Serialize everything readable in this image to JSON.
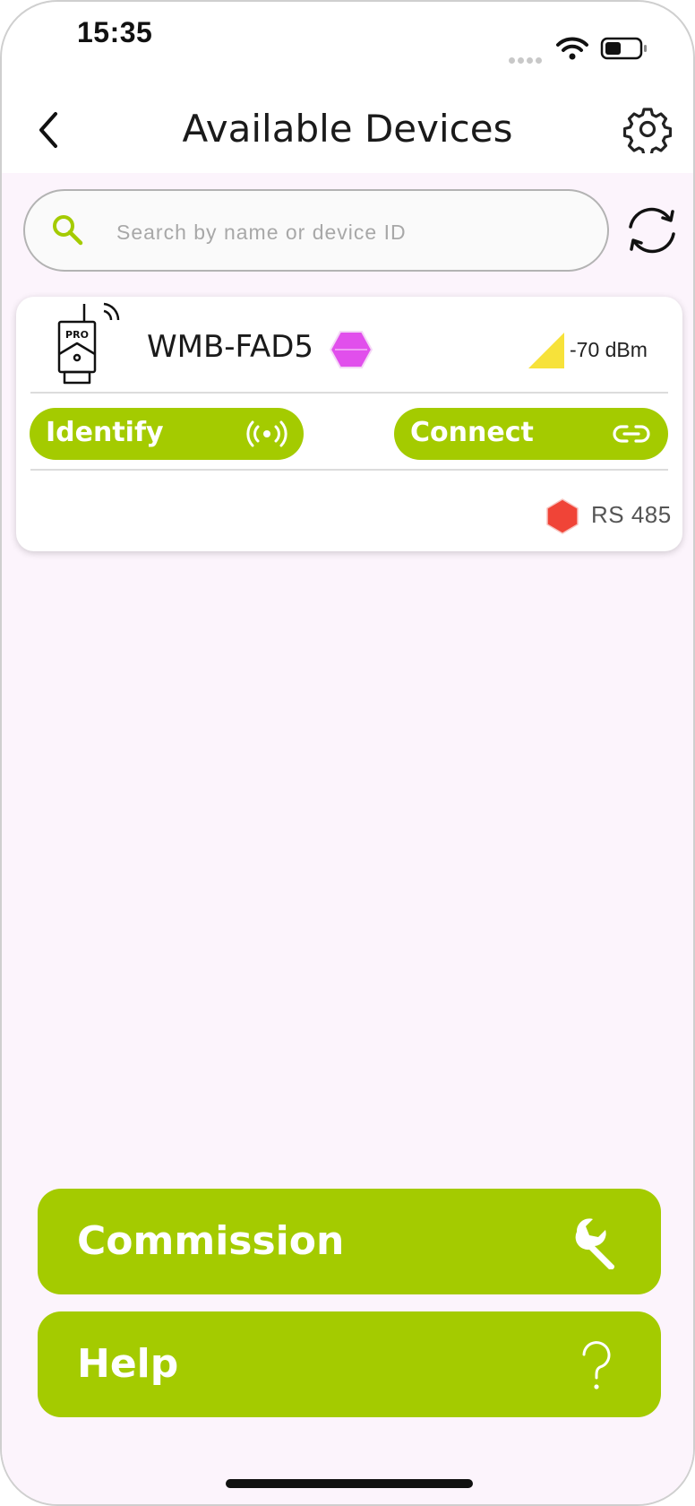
{
  "status_bar": {
    "time": "15:35",
    "icons": [
      "cellular-dots-icon",
      "wifi-icon",
      "battery-icon"
    ]
  },
  "header": {
    "title": "Available Devices",
    "back_icon": "chevron-left-icon",
    "settings_icon": "gear-icon"
  },
  "search": {
    "placeholder": "Search by name or device ID",
    "value": "",
    "icon": "search-icon",
    "refresh_icon": "refresh-icon"
  },
  "devices": [
    {
      "name": "WMB-FAD5",
      "icon": "pro-device-wireless-icon",
      "device_badge_color": "#e14fec",
      "rssi": "-70 dBm",
      "rssi_color": "#f7e23a",
      "identify_label": "Identify",
      "identify_icon": "broadcast-icon",
      "connect_label": "Connect",
      "connect_icon": "link-icon",
      "interface_label": "RS 485",
      "interface_badge_color": "#f04437"
    }
  ],
  "actions": {
    "commission_label": "Commission",
    "commission_icon": "wrench-icon",
    "help_label": "Help",
    "help_icon": "question-mark-icon"
  },
  "colors": {
    "accent": "#a4cb00",
    "background": "#fcf4fc",
    "text": "#1a1a1a"
  }
}
